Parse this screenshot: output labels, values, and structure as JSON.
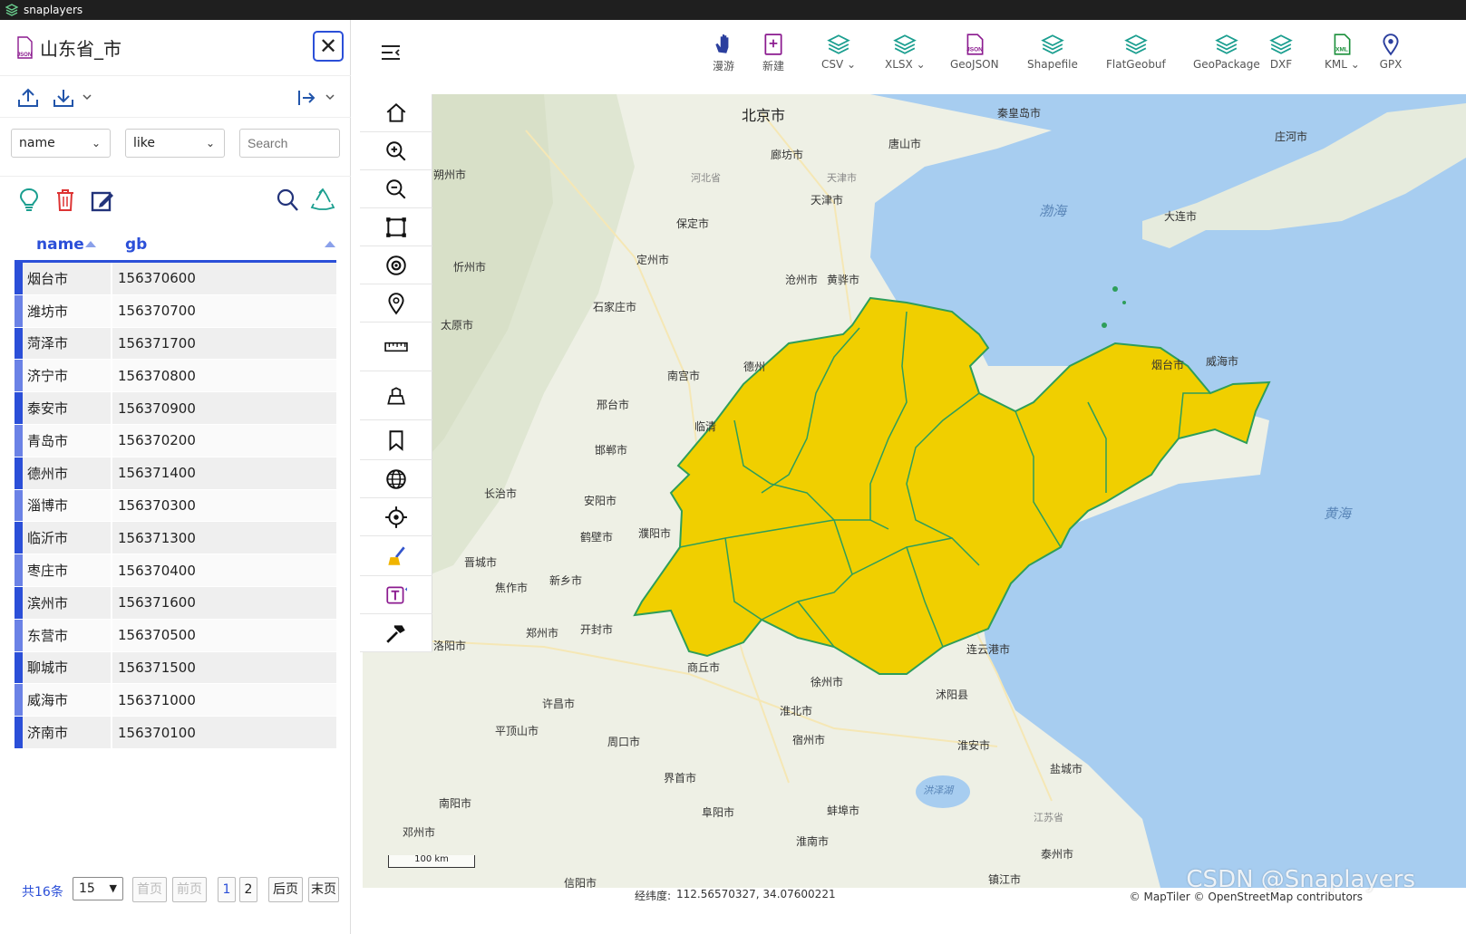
{
  "window": {
    "title": "snaplayers"
  },
  "layer_panel": {
    "title": "山东省_市",
    "json_badge": "JSON",
    "filter": {
      "field": "name",
      "operator": "like",
      "search_placeholder": "Search"
    },
    "table": {
      "columns": [
        "name",
        "gb"
      ],
      "rows": [
        {
          "name": "烟台市",
          "gb": "156370600"
        },
        {
          "name": "潍坊市",
          "gb": "156370700"
        },
        {
          "name": "菏泽市",
          "gb": "156371700"
        },
        {
          "name": "济宁市",
          "gb": "156370800"
        },
        {
          "name": "泰安市",
          "gb": "156370900"
        },
        {
          "name": "青岛市",
          "gb": "156370200"
        },
        {
          "name": "德州市",
          "gb": "156371400"
        },
        {
          "name": "淄博市",
          "gb": "156370300"
        },
        {
          "name": "临沂市",
          "gb": "156371300"
        },
        {
          "name": "枣庄市",
          "gb": "156370400"
        },
        {
          "name": "滨州市",
          "gb": "156371600"
        },
        {
          "name": "东营市",
          "gb": "156370500"
        },
        {
          "name": "聊城市",
          "gb": "156371500"
        },
        {
          "name": "威海市",
          "gb": "156371000"
        },
        {
          "name": "济南市",
          "gb": "156370100"
        }
      ]
    },
    "pager": {
      "total": "共16条",
      "page_size": "15",
      "first": "首页",
      "prev": "前页",
      "pages": [
        "1",
        "2"
      ],
      "next": "后页",
      "last": "末页"
    }
  },
  "toolbar": {
    "items": [
      {
        "label": "漫游",
        "icon": "hand-icon"
      },
      {
        "label": "新建",
        "icon": "new-file-icon"
      },
      {
        "label": "CSV",
        "icon": "layers-icon",
        "has_menu": true
      },
      {
        "label": "XLSX",
        "icon": "layers-icon",
        "has_menu": true
      },
      {
        "label": "GeoJSON",
        "icon": "json-file-icon"
      },
      {
        "label": "Shapefile",
        "icon": "layers-icon"
      },
      {
        "label": "FlatGeobuf",
        "icon": "layers-icon"
      },
      {
        "label": "GeoPackage",
        "icon": "layers-icon"
      },
      {
        "label": "DXF",
        "icon": "layers-icon"
      },
      {
        "label": "KML",
        "icon": "xml-file-icon",
        "has_menu": true
      },
      {
        "label": "GPX",
        "icon": "map-pin-icon"
      }
    ]
  },
  "map_tools": [
    "home-icon",
    "zoom-in-icon",
    "zoom-out-icon",
    "extent-icon",
    "target-icon",
    "marker-icon",
    "measure-icon",
    "basemap-icon",
    "bookmark-icon",
    "globe-icon",
    "locate-icon",
    "clear-icon",
    "text-icon",
    "hammer-icon"
  ],
  "map": {
    "labels": [
      {
        "text": "北京市",
        "kind": "big"
      },
      {
        "text": "秦皇岛市"
      },
      {
        "text": "唐山市"
      },
      {
        "text": "廊坊市"
      },
      {
        "text": "天津市"
      },
      {
        "text": "河北省",
        "kind": "prov"
      },
      {
        "text": "天津市",
        "kind": "prov"
      },
      {
        "text": "保定市"
      },
      {
        "text": "定州市"
      },
      {
        "text": "沧州市"
      },
      {
        "text": "黄骅市"
      },
      {
        "text": "石家庄市"
      },
      {
        "text": "忻州市"
      },
      {
        "text": "朔州市"
      },
      {
        "text": "太原市"
      },
      {
        "text": "南宫市"
      },
      {
        "text": "邢台市"
      },
      {
        "text": "邯郸市"
      },
      {
        "text": "长治市"
      },
      {
        "text": "安阳市"
      },
      {
        "text": "鹤壁市"
      },
      {
        "text": "濮阳市"
      },
      {
        "text": "晋城市"
      },
      {
        "text": "焦作市"
      },
      {
        "text": "新乡市"
      },
      {
        "text": "郑州市"
      },
      {
        "text": "开封市"
      },
      {
        "text": "洛阳市"
      },
      {
        "text": "商丘市"
      },
      {
        "text": "徐州市"
      },
      {
        "text": "连云港市"
      },
      {
        "text": "沭阳县"
      },
      {
        "text": "淮北市"
      },
      {
        "text": "宿州市"
      },
      {
        "text": "许昌市"
      },
      {
        "text": "平顶山市"
      },
      {
        "text": "周口市"
      },
      {
        "text": "淮安市"
      },
      {
        "text": "盐城市"
      },
      {
        "text": "界首市"
      },
      {
        "text": "阜阳市"
      },
      {
        "text": "蚌埠市"
      },
      {
        "text": "南阳市"
      },
      {
        "text": "邓州市"
      },
      {
        "text": "淮南市"
      },
      {
        "text": "泰州市"
      },
      {
        "text": "镇江市"
      },
      {
        "text": "信阳市"
      },
      {
        "text": "江苏省",
        "kind": "prov"
      },
      {
        "text": "大连市"
      },
      {
        "text": "庄河市"
      },
      {
        "text": "威海市"
      },
      {
        "text": "渤海",
        "kind": "sea"
      },
      {
        "text": "黄海",
        "kind": "sea"
      },
      {
        "text": "洪泽湖",
        "kind": "sea"
      },
      {
        "text": "临清"
      },
      {
        "text": "德州"
      },
      {
        "text": "烟台市"
      }
    ],
    "scale_label": "100 km",
    "attribution": "© MapTiler © OpenStreetMap contributors",
    "province_fill": "#f0cf00",
    "province_stroke": "#2e9e5a"
  },
  "status": {
    "coord_label": "经纬度:",
    "coord_value": "112.56570327, 34.07600221"
  },
  "watermark": "CSDN @Snaplayers"
}
